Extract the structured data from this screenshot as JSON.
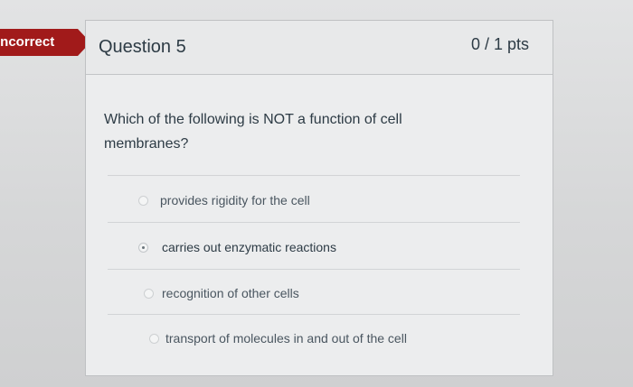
{
  "banner": {
    "status_label": "Incorrect"
  },
  "question": {
    "title": "Question 5",
    "points": "0 / 1 pts",
    "text": "Which of the following is NOT a function of cell membranes?"
  },
  "answers": [
    {
      "label": "provides rigidity for the cell",
      "selected": false
    },
    {
      "label": "carries out enzymatic reactions",
      "selected": true
    },
    {
      "label": "recognition of other cells",
      "selected": false
    },
    {
      "label": "transport of molecules in and out of the cell",
      "selected": false
    }
  ],
  "colors": {
    "incorrect_banner": "#a11a1a",
    "card_background": "#ecedee",
    "text": "#2d3b45"
  }
}
